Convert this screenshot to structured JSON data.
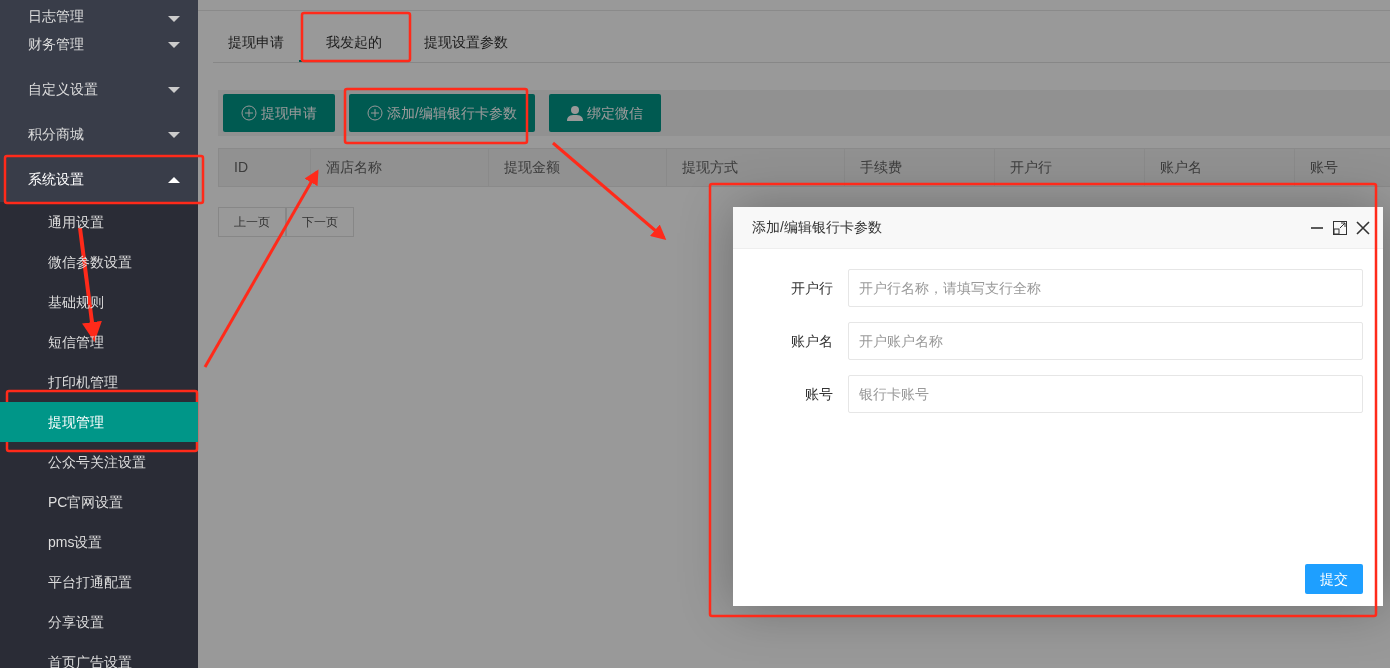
{
  "sidebar": {
    "items": [
      {
        "label": "日志管理",
        "expanded": false
      },
      {
        "label": "财务管理",
        "expanded": false
      },
      {
        "label": "自定义设置",
        "expanded": false
      },
      {
        "label": "积分商城",
        "expanded": false
      },
      {
        "label": "系统设置",
        "expanded": true,
        "children": [
          {
            "label": "通用设置",
            "selected": false
          },
          {
            "label": "微信参数设置",
            "selected": false
          },
          {
            "label": "基础规则",
            "selected": false
          },
          {
            "label": "短信管理",
            "selected": false
          },
          {
            "label": "打印机管理",
            "selected": false
          },
          {
            "label": "提现管理",
            "selected": true
          },
          {
            "label": "公众号关注设置",
            "selected": false
          },
          {
            "label": "PC官网设置",
            "selected": false
          },
          {
            "label": "pms设置",
            "selected": false
          },
          {
            "label": "平台打通配置",
            "selected": false
          },
          {
            "label": "分享设置",
            "selected": false
          },
          {
            "label": "首页广告设置",
            "selected": false
          }
        ]
      }
    ]
  },
  "tabs": [
    {
      "label": "提现申请",
      "selected": false
    },
    {
      "label": "我发起的",
      "selected": true
    },
    {
      "label": "提现设置参数",
      "selected": false
    }
  ],
  "toolbar": {
    "buttons": [
      {
        "label": "提现申请",
        "kind": "add"
      },
      {
        "label": "添加/编辑银行卡参数",
        "kind": "add"
      },
      {
        "label": "绑定微信",
        "kind": "user"
      }
    ]
  },
  "table": {
    "columns": [
      "ID",
      "酒店名称",
      "提现金额",
      "提现方式",
      "手续费",
      "开户行",
      "账户名",
      "账号"
    ]
  },
  "pager": {
    "buttons": [
      {
        "label": "上一页",
        "disabled": true
      },
      {
        "label": "下一页",
        "disabled": true
      }
    ]
  },
  "dialog": {
    "title": "添加/编辑银行卡参数",
    "fields": [
      {
        "label": "开户行",
        "placeholder": "开户行名称，请填写支行全称"
      },
      {
        "label": "账户名",
        "placeholder": "开户账户名称"
      },
      {
        "label": "账号",
        "placeholder": "银行卡账号"
      }
    ],
    "submit": "提交"
  }
}
